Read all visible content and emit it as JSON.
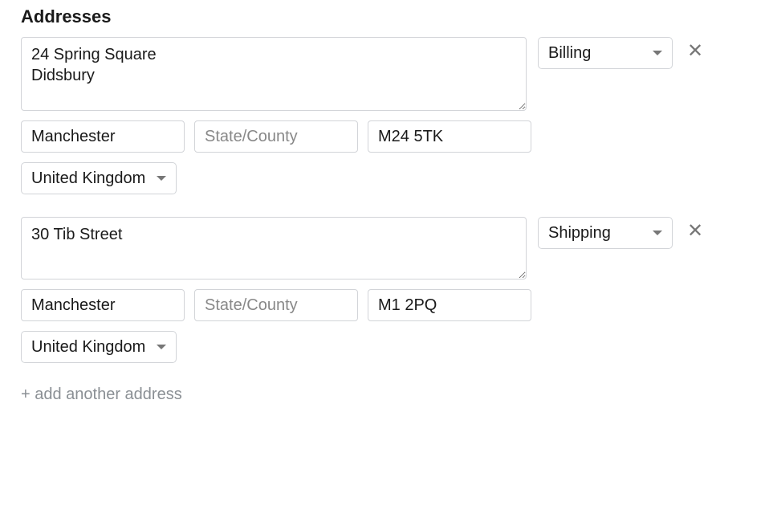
{
  "section": {
    "title": "Addresses"
  },
  "placeholders": {
    "state": "State/County"
  },
  "addresses": [
    {
      "street": "24 Spring Square\nDidsbury",
      "city": "Manchester",
      "state": "",
      "postal": "M24 5TK",
      "country": "United Kingdom",
      "type": "Billing"
    },
    {
      "street": "30 Tib Street",
      "city": "Manchester",
      "state": "",
      "postal": "M1 2PQ",
      "country": "United Kingdom",
      "type": "Shipping"
    }
  ],
  "actions": {
    "add_another": "+ add another address"
  }
}
